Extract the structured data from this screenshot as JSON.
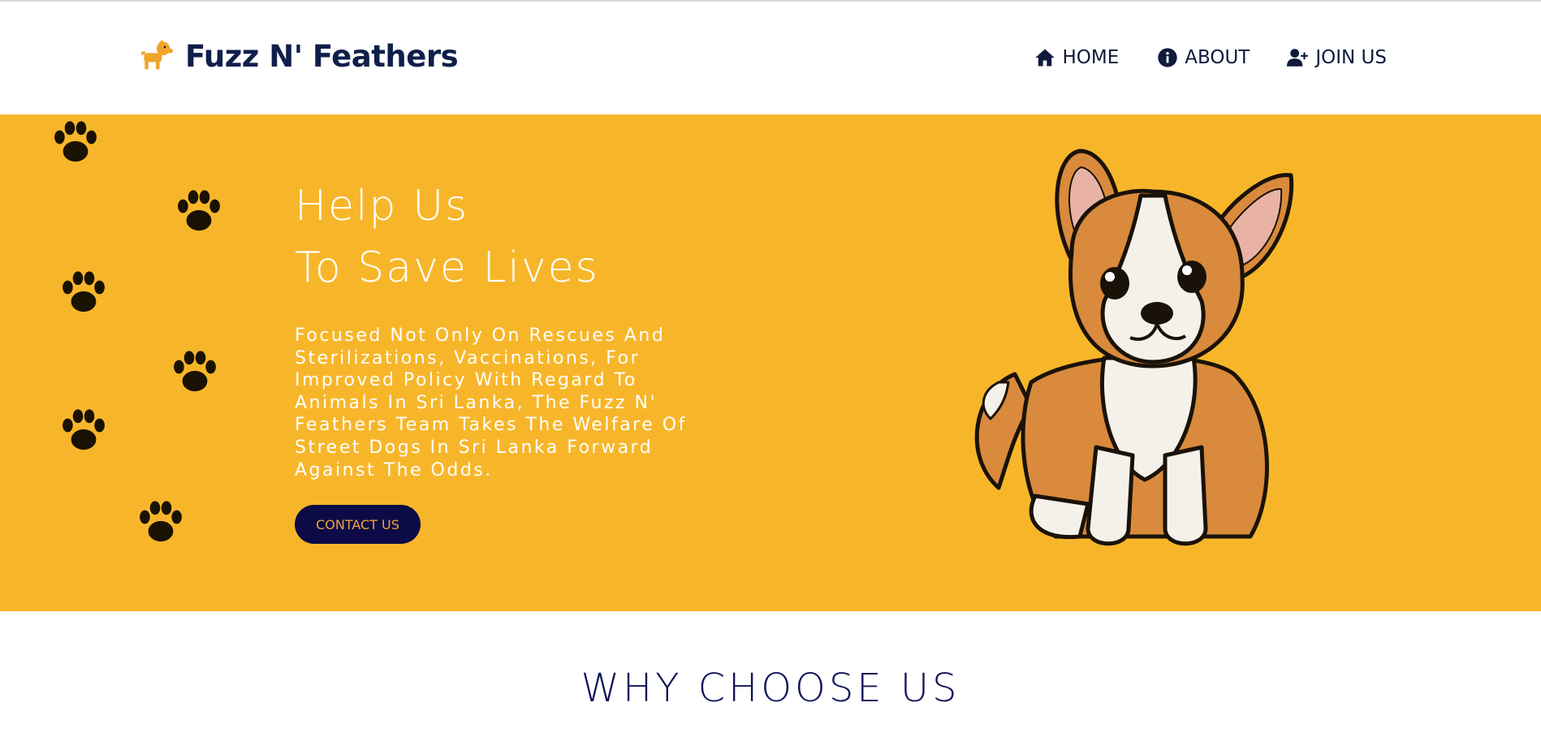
{
  "brand": {
    "name": "Fuzz N' Feathers",
    "icon": "dog-icon",
    "color": "#0f1f4a",
    "icon_color": "#f0a52a"
  },
  "nav": {
    "items": [
      {
        "label": "HOME",
        "icon": "home-icon"
      },
      {
        "label": "ABOUT",
        "icon": "info-icon"
      },
      {
        "label": "JOIN US",
        "icon": "user-plus-icon"
      }
    ]
  },
  "hero": {
    "background": "#f7b62a",
    "title_line1": "Help Us",
    "title_line2": "To Save Lives",
    "text": "Focused Not Only On Rescues And Sterilizations, Vaccinations, For Improved Policy With Regard To Animals In Sri Lanka, The Fuzz N' Feathers Team Takes The Welfare Of Street Dogs In Sri Lanka Forward Against The Odds.",
    "button_label": "CONTACT US",
    "button_color": "#0d0b47",
    "button_text_color": "#f0a23a",
    "image": "corgi-puppy-illustration",
    "decoration": "paw-print-icon"
  },
  "section": {
    "heading": "WHY CHOOSE US"
  }
}
